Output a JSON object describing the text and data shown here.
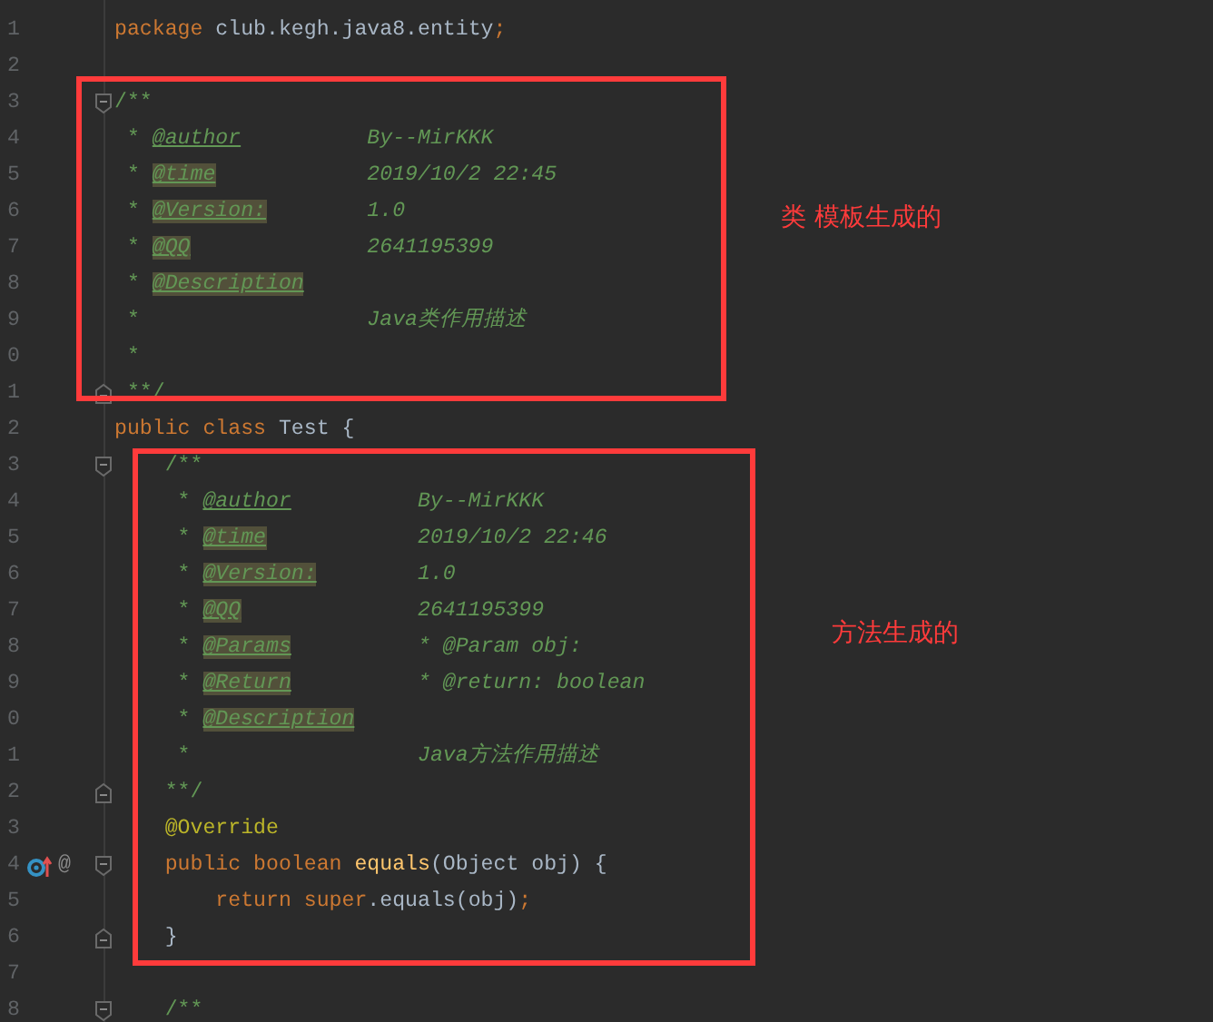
{
  "editor": {
    "lines": [
      {
        "number": "1",
        "fold_start": false,
        "fold_end": false,
        "overrides": false,
        "tokens": [
          {
            "kind": "keyword",
            "text": "package "
          },
          {
            "kind": "plain",
            "text": "club.kegh.java8.entity"
          },
          {
            "kind": "keyword",
            "text": ";"
          }
        ]
      },
      {
        "number": "2",
        "fold_start": false,
        "fold_end": false,
        "overrides": false
      },
      {
        "number": "3",
        "fold_start": true,
        "fold_end": false,
        "overrides": false,
        "tokens": [
          {
            "kind": "doc",
            "text": "/**"
          }
        ]
      },
      {
        "number": "4",
        "fold_start": false,
        "fold_end": false,
        "overrides": false,
        "tokens": [
          {
            "kind": "doc",
            "text": " * "
          },
          {
            "kind": "tag",
            "text": "@author",
            "highlighted": false
          },
          {
            "kind": "doc-text",
            "text": "          By--MirKKK"
          }
        ]
      },
      {
        "number": "5",
        "fold_start": false,
        "fold_end": false,
        "overrides": false,
        "tokens": [
          {
            "kind": "doc",
            "text": " * "
          },
          {
            "kind": "tag",
            "text": "@time",
            "highlighted": true
          },
          {
            "kind": "doc-text",
            "text": "            2019/10/2 22:45"
          }
        ]
      },
      {
        "number": "6",
        "fold_start": false,
        "fold_end": false,
        "overrides": false,
        "tokens": [
          {
            "kind": "doc",
            "text": " * "
          },
          {
            "kind": "tag",
            "text": "@Version:",
            "highlighted": true
          },
          {
            "kind": "doc-text",
            "text": "        1.0"
          }
        ]
      },
      {
        "number": "7",
        "fold_start": false,
        "fold_end": false,
        "overrides": false,
        "tokens": [
          {
            "kind": "doc",
            "text": " * "
          },
          {
            "kind": "tag",
            "text": "@QQ",
            "highlighted": true
          },
          {
            "kind": "doc-text",
            "text": "              2641195399"
          }
        ]
      },
      {
        "number": "8",
        "fold_start": false,
        "fold_end": false,
        "overrides": false,
        "tokens": [
          {
            "kind": "doc",
            "text": " * "
          },
          {
            "kind": "tag",
            "text": "@Description",
            "highlighted": true
          }
        ]
      },
      {
        "number": "9",
        "fold_start": false,
        "fold_end": false,
        "overrides": false,
        "tokens": [
          {
            "kind": "doc",
            "text": " *"
          },
          {
            "kind": "doc-text",
            "text": "                  Java类作用描述"
          }
        ]
      },
      {
        "number": "0",
        "fold_start": false,
        "fold_end": false,
        "overrides": false,
        "tokens": [
          {
            "kind": "doc",
            "text": " *"
          }
        ]
      },
      {
        "number": "1",
        "fold_start": false,
        "fold_end": true,
        "overrides": false,
        "tokens": [
          {
            "kind": "doc",
            "text": " **/"
          }
        ]
      },
      {
        "number": "2",
        "fold_start": false,
        "fold_end": false,
        "overrides": false,
        "tokens": [
          {
            "kind": "keyword",
            "text": "public class "
          },
          {
            "kind": "plain",
            "text": "Test {"
          }
        ]
      },
      {
        "number": "3",
        "fold_start": true,
        "fold_end": false,
        "overrides": false,
        "tokens": [
          {
            "kind": "doc",
            "text": "    /**"
          }
        ]
      },
      {
        "number": "4",
        "fold_start": false,
        "fold_end": false,
        "overrides": false,
        "tokens": [
          {
            "kind": "doc",
            "text": "     * "
          },
          {
            "kind": "tag",
            "text": "@author",
            "highlighted": false
          },
          {
            "kind": "doc-text",
            "text": "          By--MirKKK"
          }
        ]
      },
      {
        "number": "5",
        "fold_start": false,
        "fold_end": false,
        "overrides": false,
        "tokens": [
          {
            "kind": "doc",
            "text": "     * "
          },
          {
            "kind": "tag",
            "text": "@time",
            "highlighted": true
          },
          {
            "kind": "doc-text",
            "text": "            2019/10/2 22:46"
          }
        ]
      },
      {
        "number": "6",
        "fold_start": false,
        "fold_end": false,
        "overrides": false,
        "tokens": [
          {
            "kind": "doc",
            "text": "     * "
          },
          {
            "kind": "tag",
            "text": "@Version:",
            "highlighted": true
          },
          {
            "kind": "doc-text",
            "text": "        1.0"
          }
        ]
      },
      {
        "number": "7",
        "fold_start": false,
        "fold_end": false,
        "overrides": false,
        "tokens": [
          {
            "kind": "doc",
            "text": "     * "
          },
          {
            "kind": "tag",
            "text": "@QQ",
            "highlighted": true
          },
          {
            "kind": "doc-text",
            "text": "              2641195399"
          }
        ]
      },
      {
        "number": "8",
        "fold_start": false,
        "fold_end": false,
        "overrides": false,
        "tokens": [
          {
            "kind": "doc",
            "text": "     * "
          },
          {
            "kind": "tag",
            "text": "@Params",
            "highlighted": true
          },
          {
            "kind": "doc-text",
            "text": "          * @Param obj:"
          }
        ]
      },
      {
        "number": "9",
        "fold_start": false,
        "fold_end": false,
        "overrides": false,
        "tokens": [
          {
            "kind": "doc",
            "text": "     * "
          },
          {
            "kind": "tag",
            "text": "@Return",
            "highlighted": true
          },
          {
            "kind": "doc-text",
            "text": "          * @return: boolean"
          }
        ]
      },
      {
        "number": "0",
        "fold_start": false,
        "fold_end": false,
        "overrides": false,
        "tokens": [
          {
            "kind": "doc",
            "text": "     * "
          },
          {
            "kind": "tag",
            "text": "@Description",
            "highlighted": true
          }
        ]
      },
      {
        "number": "1",
        "fold_start": false,
        "fold_end": false,
        "overrides": false,
        "tokens": [
          {
            "kind": "doc",
            "text": "     *"
          },
          {
            "kind": "doc-text",
            "text": "                  Java方法作用描述"
          }
        ]
      },
      {
        "number": "2",
        "fold_start": false,
        "fold_end": true,
        "overrides": false,
        "tokens": [
          {
            "kind": "doc",
            "text": "    **/"
          }
        ]
      },
      {
        "number": "3",
        "fold_start": false,
        "fold_end": false,
        "overrides": false,
        "tokens": [
          {
            "kind": "annotation",
            "text": "    @Override"
          }
        ]
      },
      {
        "number": "4",
        "fold_start": true,
        "fold_end": false,
        "overrides": true,
        "gutter_text": "@",
        "tokens": [
          {
            "kind": "keyword",
            "text": "    public boolean "
          },
          {
            "kind": "method",
            "text": "equals"
          },
          {
            "kind": "plain",
            "text": "(Object obj) {"
          }
        ]
      },
      {
        "number": "5",
        "fold_start": false,
        "fold_end": false,
        "overrides": false,
        "tokens": [
          {
            "kind": "keyword",
            "text": "        return super"
          },
          {
            "kind": "plain",
            "text": ".equals(obj)"
          },
          {
            "kind": "keyword",
            "text": ";"
          }
        ]
      },
      {
        "number": "6",
        "fold_start": false,
        "fold_end": true,
        "overrides": false,
        "tokens": [
          {
            "kind": "plain",
            "text": "    }"
          }
        ]
      },
      {
        "number": "7",
        "fold_start": false,
        "fold_end": false,
        "overrides": false
      },
      {
        "number": "8",
        "fold_start": true,
        "fold_end": false,
        "overrides": false,
        "tokens": [
          {
            "kind": "doc",
            "text": "    /**"
          }
        ]
      }
    ]
  },
  "callouts": [
    {
      "label": "类  模板生成的"
    },
    {
      "label": "方法生成的"
    }
  ]
}
